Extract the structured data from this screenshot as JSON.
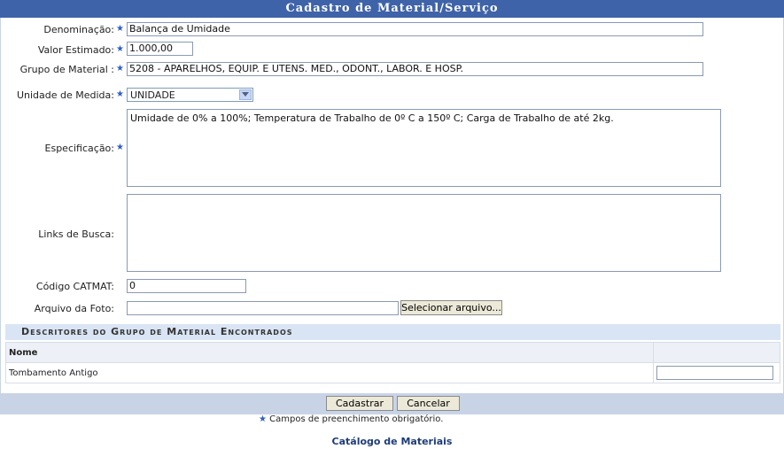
{
  "title": "Cadastro de Material/Serviço",
  "form": {
    "denominacao_label": "Denominação:",
    "denominacao_value": "Balança de Umidade",
    "valor_label": "Valor Estimado:",
    "valor_value": "1.000,00",
    "grupo_label": "Grupo de Material :",
    "grupo_value": "5208 - APARELHOS, EQUIP. E UTENS. MED., ODONT., LABOR. E HOSP.",
    "unidade_label": "Unidade de Medida:",
    "unidade_value": "UNIDADE",
    "especificacao_label": "Especificação:",
    "especificacao_value": "Umidade de 0% a 100%; Temperatura de Trabalho de 0º C a 150º C; Carga de Trabalho de até 2kg.",
    "links_label": "Links de Busca:",
    "links_value": "",
    "catmat_label": "Código CATMAT:",
    "catmat_value": "0",
    "foto_label": "Arquivo da Foto:",
    "foto_value": "",
    "select_file_button": "Selecionar arquivo..."
  },
  "descriptors": {
    "title": "Descritores do Grupo de Material Encontrados",
    "column_header": "Nome",
    "rows": [
      {
        "nome": "Tombamento Antigo",
        "value": ""
      }
    ]
  },
  "actions": {
    "submit": "Cadastrar",
    "cancel": "Cancelar"
  },
  "required_note": "Campos de preenchimento obrigatório.",
  "catalog_link": "Catálogo de Materiais",
  "colors": {
    "title_bar": "#3f63a8",
    "star": "#2d5ec9",
    "section_bg": "#d9e4f4",
    "footer_bar": "#c8d4e6"
  }
}
